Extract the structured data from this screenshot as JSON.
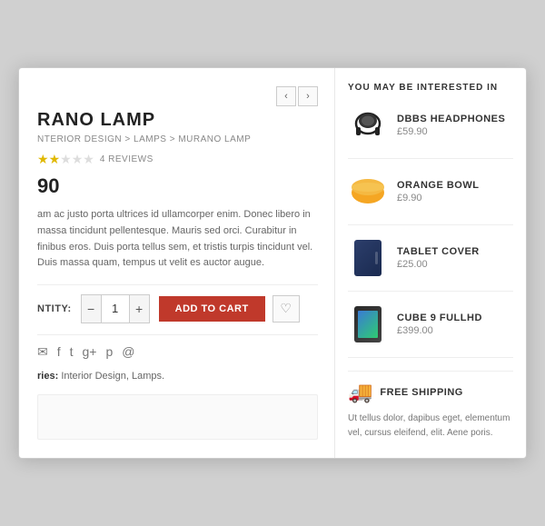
{
  "window": {
    "left": {
      "nav_prev": "‹",
      "nav_next": "›",
      "title": "RANO LAMP",
      "breadcrumb": "NTERIOR DESIGN > LAMPS > MURANO LAMP",
      "stars": [
        true,
        true,
        false,
        false,
        false
      ],
      "reviews_count": "4 REVIEWS",
      "price": "90",
      "description": "am ac justo porta ultrices id ullamcorper enim. Donec libero in massa tincidunt pellentesque. Mauris sed orci. Curabitur in finibus eros. Duis porta tellus sem, et tristis turpis tincidunt vel. Duis massa quam, tempus ut velit es auctor augue.",
      "quantity_label": "NTITY:",
      "qty_value": "1",
      "qty_minus": "−",
      "qty_plus": "+",
      "add_to_cart_label": "ADD TO CART",
      "wishlist_icon": "♡",
      "share_icons": [
        "f",
        "t",
        "g+",
        "p",
        "✉"
      ],
      "categories_label": "ries:",
      "categories_value": "Interior Design, Lamps."
    },
    "right": {
      "section_title": "YOU MAY BE INTERESTED IN",
      "products": [
        {
          "name": "DBBS HEADPHONES",
          "price": "£59.90",
          "type": "headphones"
        },
        {
          "name": "ORANGE BOWL",
          "price": "£9.90",
          "type": "bowl"
        },
        {
          "name": "TABLET COVER",
          "price": "£25.00",
          "type": "tablet-cover"
        },
        {
          "name": "CUBE 9 FULLHD",
          "price": "£399.00",
          "type": "tablet"
        }
      ],
      "shipping": {
        "title": "FREE SHIPPING",
        "description": "Ut tellus dolor, dapibus eget, elementum vel, cursus eleifend, elit. Aene poris."
      }
    }
  }
}
